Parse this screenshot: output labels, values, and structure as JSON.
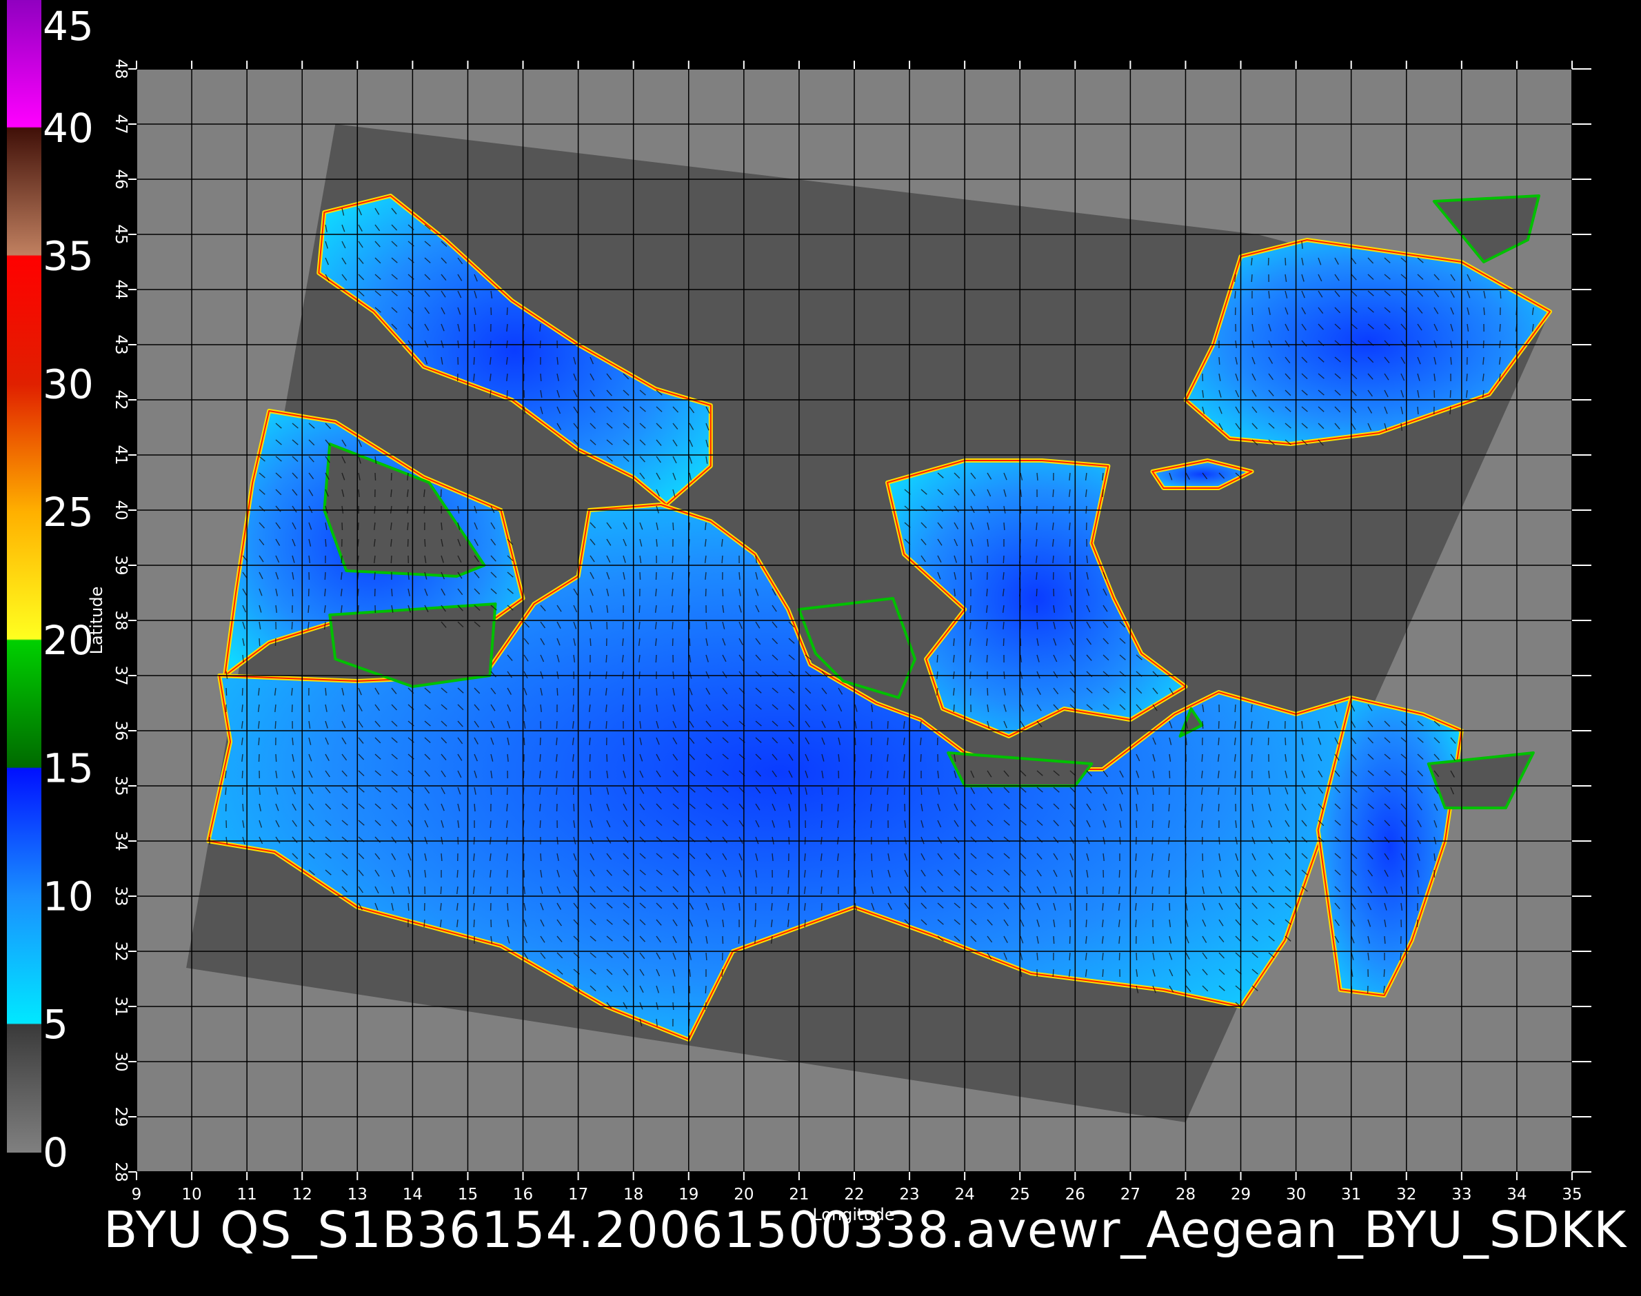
{
  "caption": "BYU  QS_S1B36154.20061500338.avewr_Aegean_BYU_SDKK",
  "colors": {
    "background": "#000000",
    "plot_background": "#808080",
    "swath": "#555555",
    "land": "#464646",
    "grid": "#000000"
  },
  "colorbar": {
    "labels": [
      "45",
      "40",
      "35",
      "30",
      "25",
      "20",
      "15",
      "10",
      "5",
      "0"
    ],
    "range": [
      0,
      45
    ],
    "stops": [
      {
        "value": 0,
        "color": "#808080"
      },
      {
        "value": 5,
        "color": "#3a3a3a"
      },
      {
        "value": 5.05,
        "color": "#00e8ff"
      },
      {
        "value": 10,
        "color": "#1a90ff"
      },
      {
        "value": 15,
        "color": "#0010ff"
      },
      {
        "value": 15.05,
        "color": "#006a00"
      },
      {
        "value": 20,
        "color": "#00d000"
      },
      {
        "value": 20.05,
        "color": "#ffff20"
      },
      {
        "value": 25,
        "color": "#ffb000"
      },
      {
        "value": 30,
        "color": "#e02000"
      },
      {
        "value": 35,
        "color": "#ff0000"
      },
      {
        "value": 35.05,
        "color": "#c08060"
      },
      {
        "value": 40,
        "color": "#401008"
      },
      {
        "value": 40.05,
        "color": "#ff00ff"
      },
      {
        "value": 45,
        "color": "#9000c0"
      }
    ]
  },
  "map": {
    "lon_range": [
      9,
      35
    ],
    "lat_range": [
      28,
      48
    ],
    "x_label": "Longitude",
    "y_label": "Latitude",
    "x_ticks": [
      "9",
      "10",
      "11",
      "12",
      "13",
      "14",
      "15",
      "16",
      "17",
      "18",
      "19",
      "20",
      "21",
      "22",
      "23",
      "24",
      "25",
      "26",
      "27",
      "28",
      "29",
      "30",
      "31",
      "32",
      "33",
      "34",
      "35"
    ],
    "y_ticks": [
      "28",
      "29",
      "30",
      "31",
      "32",
      "33",
      "34",
      "35",
      "36",
      "37",
      "38",
      "39",
      "40",
      "41",
      "42",
      "43",
      "44",
      "45",
      "46",
      "47",
      "48"
    ],
    "grid": true,
    "swath_corners_lonlat": [
      [
        12.6,
        47.0
      ],
      [
        29.3,
        45.0
      ],
      [
        34.6,
        43.6
      ],
      [
        28.0,
        28.9
      ],
      [
        9.9,
        31.7
      ]
    ],
    "seas": [
      {
        "name": "adriatic",
        "points": [
          [
            12.4,
            45.4
          ],
          [
            13.6,
            45.7
          ],
          [
            14.6,
            44.9
          ],
          [
            15.8,
            43.8
          ],
          [
            17.0,
            43.0
          ],
          [
            18.4,
            42.2
          ],
          [
            19.4,
            41.9
          ],
          [
            19.4,
            40.8
          ],
          [
            18.6,
            40.1
          ],
          [
            18.0,
            40.6
          ],
          [
            17.0,
            41.1
          ],
          [
            15.8,
            42.0
          ],
          [
            14.2,
            42.6
          ],
          [
            13.3,
            43.6
          ],
          [
            12.3,
            44.3
          ]
        ]
      },
      {
        "name": "tyrrhenian",
        "points": [
          [
            11.4,
            41.8
          ],
          [
            12.6,
            41.6
          ],
          [
            14.2,
            40.6
          ],
          [
            15.6,
            40.0
          ],
          [
            16.0,
            38.4
          ],
          [
            15.3,
            37.9
          ],
          [
            13.0,
            38.1
          ],
          [
            11.4,
            37.6
          ],
          [
            10.6,
            37.0
          ],
          [
            10.8,
            38.5
          ],
          [
            11.1,
            40.5
          ]
        ]
      },
      {
        "name": "ionian_central",
        "points": [
          [
            10.5,
            37.0
          ],
          [
            13.0,
            36.9
          ],
          [
            15.3,
            37.0
          ],
          [
            16.2,
            38.3
          ],
          [
            17.0,
            38.8
          ],
          [
            17.2,
            40.0
          ],
          [
            18.5,
            40.1
          ],
          [
            19.4,
            39.8
          ],
          [
            20.2,
            39.2
          ],
          [
            20.8,
            38.2
          ],
          [
            21.2,
            37.2
          ],
          [
            22.4,
            36.5
          ],
          [
            23.2,
            36.2
          ],
          [
            24.0,
            35.6
          ],
          [
            25.0,
            35.3
          ],
          [
            26.5,
            35.3
          ],
          [
            27.8,
            36.3
          ],
          [
            28.6,
            36.7
          ],
          [
            30.0,
            36.3
          ],
          [
            31.0,
            36.6
          ],
          [
            30.6,
            34.5
          ],
          [
            29.8,
            32.2
          ],
          [
            29.0,
            31.0
          ],
          [
            27.6,
            31.3
          ],
          [
            25.2,
            31.6
          ],
          [
            23.4,
            32.3
          ],
          [
            22.0,
            32.8
          ],
          [
            19.8,
            32.0
          ],
          [
            19.0,
            30.4
          ],
          [
            17.5,
            31.0
          ],
          [
            15.6,
            32.1
          ],
          [
            13.0,
            32.8
          ],
          [
            11.5,
            33.8
          ],
          [
            10.3,
            34.0
          ],
          [
            10.7,
            35.8
          ]
        ]
      },
      {
        "name": "aegean",
        "points": [
          [
            22.6,
            40.5
          ],
          [
            24.0,
            40.9
          ],
          [
            25.4,
            40.9
          ],
          [
            26.6,
            40.8
          ],
          [
            26.3,
            39.4
          ],
          [
            26.7,
            38.4
          ],
          [
            27.2,
            37.4
          ],
          [
            28.0,
            36.8
          ],
          [
            27.0,
            36.2
          ],
          [
            25.8,
            36.4
          ],
          [
            24.8,
            35.9
          ],
          [
            23.6,
            36.4
          ],
          [
            23.3,
            37.3
          ],
          [
            24.0,
            38.2
          ],
          [
            22.9,
            39.2
          ]
        ]
      },
      {
        "name": "black_sea",
        "points": [
          [
            28.5,
            43.0
          ],
          [
            29.0,
            44.6
          ],
          [
            30.2,
            44.9
          ],
          [
            31.6,
            44.7
          ],
          [
            33.0,
            44.5
          ],
          [
            34.6,
            43.6
          ],
          [
            33.5,
            42.1
          ],
          [
            31.5,
            41.4
          ],
          [
            29.9,
            41.2
          ],
          [
            28.8,
            41.3
          ],
          [
            28.0,
            42.0
          ]
        ]
      },
      {
        "name": "marmara",
        "points": [
          [
            27.4,
            40.7
          ],
          [
            28.4,
            40.9
          ],
          [
            29.2,
            40.7
          ],
          [
            28.6,
            40.4
          ],
          [
            27.6,
            40.4
          ]
        ]
      },
      {
        "name": "levant",
        "points": [
          [
            31.0,
            36.6
          ],
          [
            32.3,
            36.3
          ],
          [
            33.0,
            36.0
          ],
          [
            32.7,
            34.0
          ],
          [
            32.1,
            32.2
          ],
          [
            31.6,
            31.2
          ],
          [
            30.8,
            31.3
          ],
          [
            30.4,
            34.2
          ]
        ]
      }
    ],
    "land_over_sea": [
      {
        "name": "sardinia",
        "points": [
          [
            12.5,
            41.2
          ],
          [
            14.3,
            40.5
          ],
          [
            15.3,
            39.0
          ],
          [
            14.8,
            38.8
          ],
          [
            12.8,
            38.9
          ],
          [
            12.4,
            40.0
          ]
        ]
      },
      {
        "name": "sicily",
        "points": [
          [
            12.5,
            38.1
          ],
          [
            15.5,
            38.3
          ],
          [
            15.4,
            37.0
          ],
          [
            14.0,
            36.8
          ],
          [
            12.6,
            37.3
          ]
        ]
      },
      {
        "name": "peloponnese",
        "points": [
          [
            21.0,
            38.2
          ],
          [
            22.7,
            38.4
          ],
          [
            23.1,
            37.3
          ],
          [
            22.8,
            36.6
          ],
          [
            21.8,
            36.9
          ],
          [
            21.3,
            37.4
          ]
        ]
      },
      {
        "name": "crete",
        "points": [
          [
            23.7,
            35.6
          ],
          [
            26.3,
            35.4
          ],
          [
            26.0,
            35.0
          ],
          [
            24.0,
            35.0
          ]
        ]
      },
      {
        "name": "rhodes",
        "points": [
          [
            28.1,
            36.4
          ],
          [
            28.3,
            36.1
          ],
          [
            27.9,
            35.9
          ]
        ]
      },
      {
        "name": "cyprus",
        "points": [
          [
            32.4,
            35.4
          ],
          [
            34.3,
            35.6
          ],
          [
            33.8,
            34.6
          ],
          [
            32.7,
            34.6
          ]
        ]
      },
      {
        "name": "crimea",
        "points": [
          [
            32.5,
            45.6
          ],
          [
            34.4,
            45.7
          ],
          [
            34.2,
            44.9
          ],
          [
            33.4,
            44.5
          ]
        ]
      }
    ]
  }
}
